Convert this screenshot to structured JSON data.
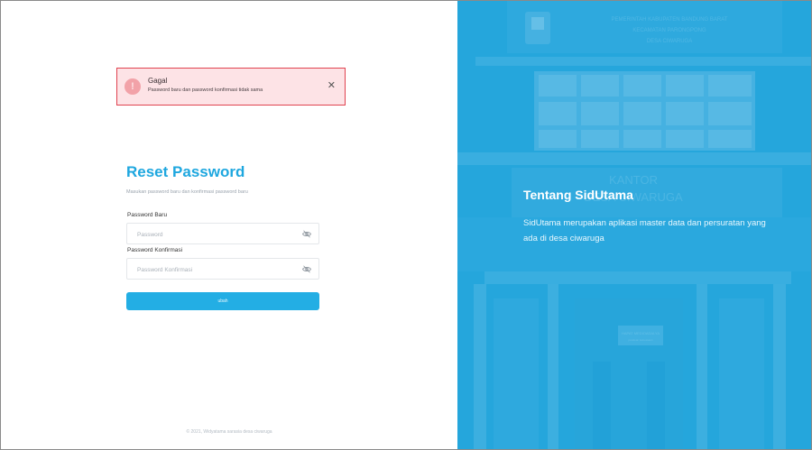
{
  "alert": {
    "title": "Gagal",
    "message": "Password baru dan password konfirmasi tidak sama",
    "icon": "alert-circle-icon",
    "close_symbol": "✕"
  },
  "form": {
    "title": "Reset Password",
    "subtitle": "Masukan password baru dan konfirmasi password baru",
    "new_password_label": "Password Baru",
    "new_password_placeholder": "Password",
    "confirm_password_label": "Password Konfirmasi",
    "confirm_password_placeholder": "Password Konfirmasi",
    "submit_label": "ubah"
  },
  "footer": {
    "text": "© 2021, Widyatama sarasia desa ciwaruga"
  },
  "info": {
    "title": "Tentang SidUtama",
    "description": "SidUtama merupakan aplikasi master data dan persuratan yang ada di desa ciwaruga"
  },
  "background_image": {
    "signboard_top_line": "PEMERINTAH KABUPATEN BANDUNG BARAT",
    "signboard_mid_line": "KECAMATAN PARONGPONG",
    "signboard_bottom_line": "DESA CIWARUGA",
    "facade_text_1": "KANTOR",
    "facade_text_2": "DESA CIWARUGA",
    "plaque_text": "HAPAT MEDIOADALYA",
    "plaque_subtext": "pandean kekuasaan"
  },
  "colors": {
    "accent": "#1ea7df",
    "button": "#23aee4",
    "panel_overlay": "#2aa7dc",
    "alert_bg": "#fde3e6",
    "alert_border": "#e0424f"
  }
}
